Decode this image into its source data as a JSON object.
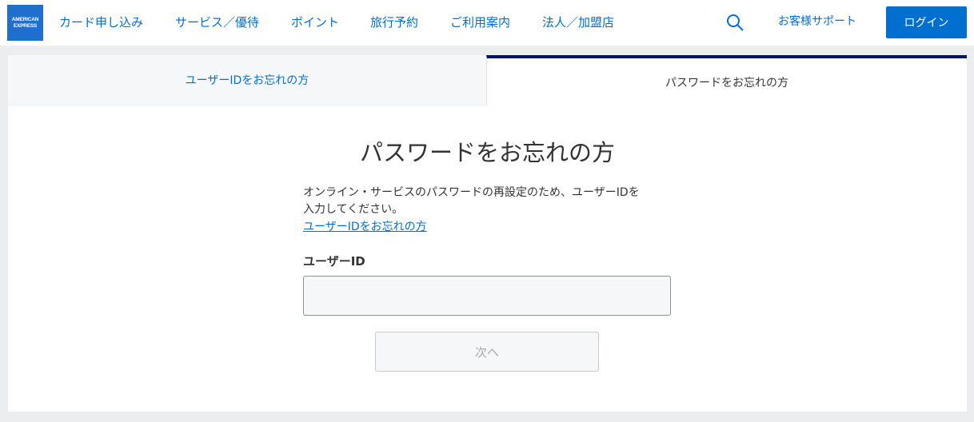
{
  "header": {
    "logo_lines": [
      "AMERICAN",
      "EXPRESS"
    ],
    "nav": [
      {
        "label": "カード申し込み"
      },
      {
        "label": "サービス／優待"
      },
      {
        "label": "ポイント"
      },
      {
        "label": "旅行予約"
      },
      {
        "label": "ご利用案内"
      },
      {
        "label": "法人／加盟店"
      }
    ],
    "search_icon": "search-icon",
    "support_label": "お客様サポート",
    "login_label": "ログイン"
  },
  "tabs": [
    {
      "label": "ユーザーIDをお忘れの方",
      "active": false
    },
    {
      "label": "パスワードをお忘れの方",
      "active": true
    }
  ],
  "main": {
    "title": "パスワードをお忘れの方",
    "description_line1": "オンライン・サービスのパスワードの再設定のため、ユーザーIDを",
    "description_line2": "入力してください。",
    "forgot_userid_link": "ユーザーIDをお忘れの方",
    "userid_label": "ユーザーID",
    "userid_value": "",
    "next_button_label": "次へ",
    "next_button_enabled": false
  },
  "colors": {
    "brand_blue": "#006fcf",
    "tab_active_border": "#00175a",
    "page_background": "#ecedee"
  }
}
